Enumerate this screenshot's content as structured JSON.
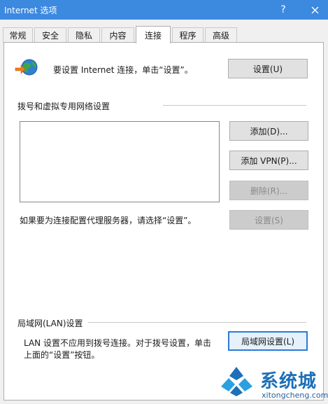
{
  "window": {
    "title": "Internet 选项",
    "help_glyph": "?",
    "close_icon": "close-icon"
  },
  "tabs": [
    {
      "label": "常规"
    },
    {
      "label": "安全"
    },
    {
      "label": "隐私"
    },
    {
      "label": "内容"
    },
    {
      "label": "连接",
      "active": true
    },
    {
      "label": "程序"
    },
    {
      "label": "高级"
    }
  ],
  "setup": {
    "icon": "globe-connect-icon",
    "text": "要设置 Internet 连接，单击“设置”。",
    "button_label": "设置(U)"
  },
  "dialup": {
    "heading": "拨号和虚拟专用网络设置",
    "add_label": "添加(D)...",
    "add_vpn_label": "添加 VPN(P)...",
    "remove_label": "删除(R)...",
    "proxy_text": "如果要为连接配置代理服务器，请选择“设置”。",
    "settings_label": "设置(S)"
  },
  "lan": {
    "heading": "局域网(LAN)设置",
    "text_line1": "LAN 设置不应用到拨号连接。对于拨号设置，单击",
    "text_line2": "上面的“设置”按钮。",
    "button_label": "局域网设置(L)"
  },
  "watermark": {
    "text": "系统城",
    "url": "xitongcheng.com"
  },
  "colors": {
    "titlebar": "#3c89e0",
    "accent": "#2c7ad6",
    "watermark": "#1c6fb8"
  }
}
